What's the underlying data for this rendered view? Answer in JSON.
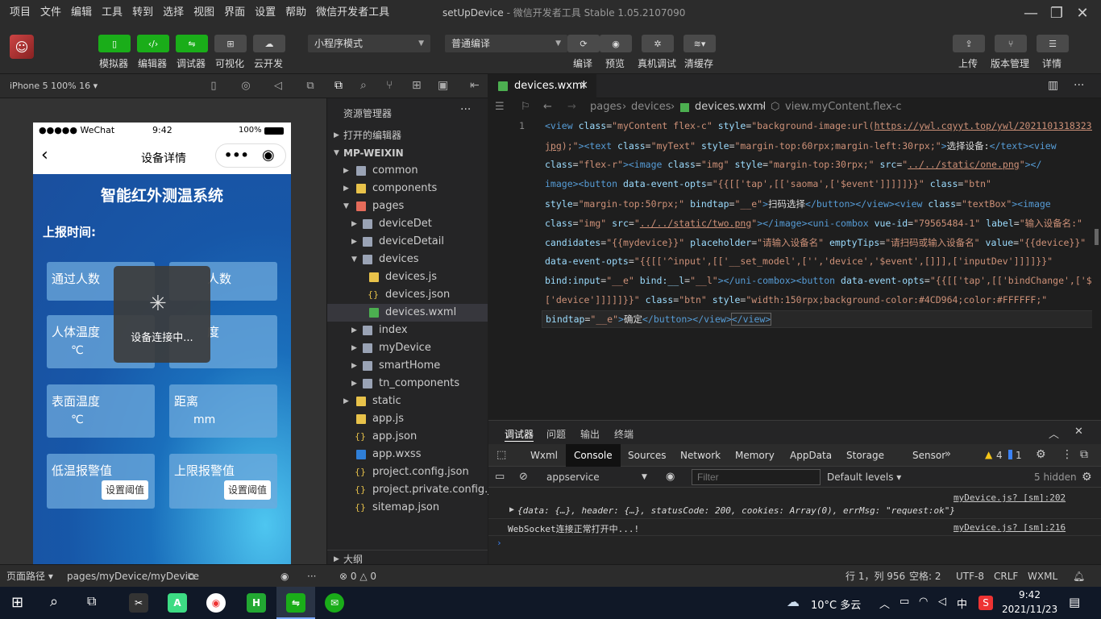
{
  "menubar": {
    "items": [
      "项目",
      "文件",
      "编辑",
      "工具",
      "转到",
      "选择",
      "视图",
      "界面",
      "设置",
      "帮助",
      "微信开发者工具"
    ],
    "title_main": "setUpDevice",
    "title_sub": "- 微信开发者工具 Stable 1.05.2107090"
  },
  "toolbar": {
    "simulator": "模拟器",
    "editor": "编辑器",
    "debugger": "调试器",
    "visual": "可视化",
    "cloud": "云开发",
    "mode_select": "小程序模式",
    "compile_select": "普通编译",
    "compile": "编译",
    "preview": "预览",
    "real_debug": "真机调试",
    "clear_cache": "清缓存",
    "upload": "上传",
    "version": "版本管理",
    "details": "详情"
  },
  "simulator": {
    "device": "iPhone 5 100% 16",
    "status_carrier": "●●●●● WeChat",
    "status_time": "9:42",
    "status_battery": "100%",
    "nav_title": "设备详情",
    "app_title": "智能红外测温系统",
    "report_label": "上报时间:",
    "cards": [
      {
        "label": "通过人数",
        "unit": ""
      },
      {
        "label": "人数",
        "unit": ""
      },
      {
        "label": "人体温度",
        "unit": "℃"
      },
      {
        "label": "度",
        "unit": ""
      },
      {
        "label": "表面温度",
        "unit": "℃"
      },
      {
        "label": "距离",
        "unit": "mm"
      },
      {
        "label": "低温报警值",
        "unit": ""
      },
      {
        "label": "上限报警值",
        "unit": ""
      }
    ],
    "set_button": "设置阈值",
    "toast_text": "设备连接中...",
    "footer_path_label": "页面路径",
    "footer_path": "pages/myDevice/myDevice"
  },
  "explorer": {
    "title": "资源管理器",
    "open_editors": "打开的编辑器",
    "project": "MP-WEIXIN",
    "outline": "大纲",
    "items": [
      {
        "name": "common"
      },
      {
        "name": "components"
      },
      {
        "name": "pages"
      },
      {
        "name": "deviceDet"
      },
      {
        "name": "deviceDetail"
      },
      {
        "name": "devices"
      },
      {
        "name": "devices.js"
      },
      {
        "name": "devices.json"
      },
      {
        "name": "devices.wxml"
      },
      {
        "name": "index"
      },
      {
        "name": "myDevice"
      },
      {
        "name": "smartHome"
      },
      {
        "name": "tn_components"
      },
      {
        "name": "static"
      },
      {
        "name": "app.js"
      },
      {
        "name": "app.json"
      },
      {
        "name": "app.wxss"
      },
      {
        "name": "project.config.json"
      },
      {
        "name": "project.private.config.js..."
      },
      {
        "name": "sitemap.json"
      }
    ]
  },
  "editor": {
    "tab_name": "devices.wxml",
    "breadcrumb": [
      "pages",
      "devices",
      "devices.wxml",
      "view.myContent.flex-c"
    ],
    "line_number": "1"
  },
  "devtools": {
    "panel_tabs": [
      "调试器",
      "问题",
      "输出",
      "终端"
    ],
    "tabs": [
      "Wxml",
      "Console",
      "Sources",
      "Network",
      "Memory",
      "AppData",
      "Storage",
      "Sensor"
    ],
    "warn_count": "4",
    "info_count": "1",
    "context": "appservice",
    "filter_placeholder": "Filter",
    "levels": "Default levels",
    "hidden": "5 hidden",
    "log1_source": "myDevice.js? [sm]:202",
    "log1_text": "{data: {…}, header: {…}, statusCode: 200, cookies: Array(0), errMsg: \"request:ok\"}",
    "log2_source": "myDevice.js? [sm]:216",
    "log2_text": "WebSocket连接正常打开中...!"
  },
  "statusbar": {
    "errors": "0",
    "warnings": "0",
    "position": "行 1，列 956",
    "spaces": "空格: 2",
    "encoding": "UTF-8",
    "eol": "CRLF",
    "lang": "WXML"
  },
  "taskbar": {
    "weather": "10°C 多云",
    "ime": "中",
    "time": "9:42",
    "date": "2021/11/23"
  },
  "colors": {
    "green": "#1aad19",
    "accent": "#4CD964"
  }
}
